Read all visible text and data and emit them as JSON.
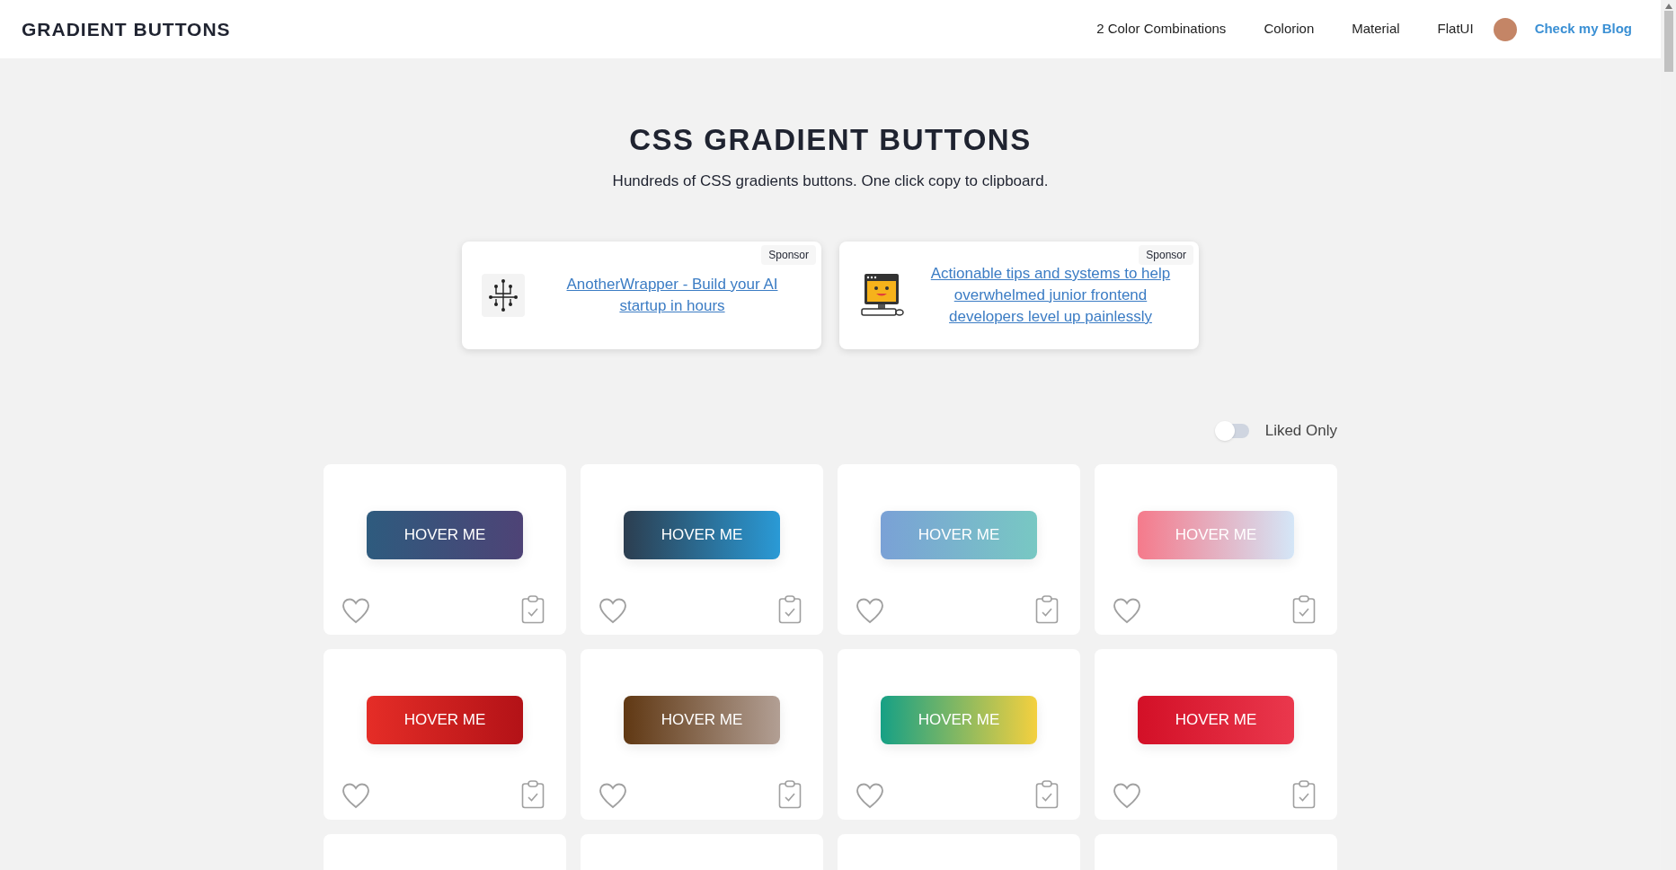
{
  "header": {
    "logo": "GRADIENT BUTTONS",
    "nav": [
      "2 Color Combinations",
      "Colorion",
      "Material",
      "FlatUI"
    ],
    "blog_link": "Check my Blog"
  },
  "hero": {
    "title": "CSS GRADIENT BUTTONS",
    "subtitle": "Hundreds of CSS gradients buttons. One click copy to clipboard."
  },
  "sponsors": [
    {
      "kind": "circuit",
      "badge": "Sponsor",
      "text": "AnotherWrapper - Build your AI startup in hours"
    },
    {
      "kind": "computer",
      "badge": "Sponsor",
      "text": "Actionable tips and systems to help overwhelmed junior frontend developers level up painlessly"
    }
  ],
  "filter": {
    "label": "Liked Only",
    "on": false
  },
  "cards": [
    {
      "button": "HOVER ME",
      "stops": [
        {
          "color": "#2e5b7e"
        },
        {
          "color": "#4e4376"
        }
      ],
      "liked": false
    },
    {
      "button": "HOVER ME",
      "stops": [
        {
          "color": "#2c3e50"
        },
        {
          "color": "#2a9ad6"
        }
      ],
      "liked": false
    },
    {
      "button": "HOVER ME",
      "stops": [
        {
          "color": "#7aa1d6"
        },
        {
          "color": "#78c8c3"
        }
      ],
      "liked": false
    },
    {
      "button": "HOVER ME",
      "stops": [
        {
          "color": "#f57a8b"
        },
        {
          "color": "#d4e6f7"
        }
      ],
      "liked": false
    },
    {
      "button": "HOVER ME",
      "stops": [
        {
          "color": "#e52d27"
        },
        {
          "color": "#b31217"
        }
      ],
      "liked": false
    },
    {
      "button": "HOVER ME",
      "stops": [
        {
          "color": "#603813"
        },
        {
          "color": "#b29f94"
        }
      ],
      "liked": false
    },
    {
      "button": "HOVER ME",
      "stops": [
        {
          "color": "#16a085"
        },
        {
          "color": "#f4d03f"
        }
      ],
      "liked": false
    },
    {
      "button": "HOVER ME",
      "stops": [
        {
          "color": "#d31027"
        },
        {
          "color": "#ea384d"
        }
      ],
      "liked": false
    }
  ]
}
